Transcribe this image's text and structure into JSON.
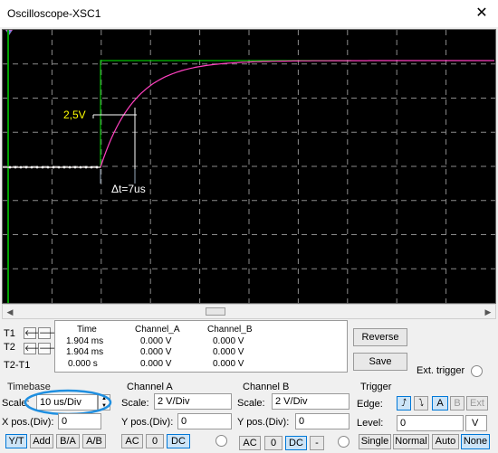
{
  "window": {
    "title": "Oscilloscope-XSC1",
    "close_glyph": "✕"
  },
  "screen": {
    "annotation_voltage": "2,5V",
    "annotation_delta": "Δt=7us",
    "trace_colors": {
      "channel_a": "#00c000",
      "channel_b": "#ff40c0",
      "cursor": "#ffffff",
      "grid": "#808080",
      "annotation": "#ffff00"
    }
  },
  "cursors": {
    "t1_label": "T1",
    "t2_label": "T2",
    "diff_label": "T2-T1",
    "arrow_left": "🡐",
    "arrow_right": "🡒"
  },
  "readout": {
    "headers": [
      "Time",
      "Channel_A",
      "Channel_B"
    ],
    "rows": [
      [
        "1.904 ms",
        "0.000 V",
        "0.000 V"
      ],
      [
        "1.904 ms",
        "0.000 V",
        "0.000 V"
      ],
      [
        "0.000 s",
        "0.000 V",
        "0.000 V"
      ]
    ]
  },
  "actions": {
    "reverse": "Reverse",
    "save": "Save",
    "ext_trigger": "Ext. trigger"
  },
  "timebase": {
    "group": "Timebase",
    "scale_label": "Scale:",
    "scale_value": "10 us/Div",
    "xpos_label": "X pos.(Div):",
    "xpos_value": "0",
    "modes": [
      "Y/T",
      "Add",
      "B/A",
      "A/B"
    ],
    "active_mode": "Y/T"
  },
  "channel_a": {
    "group": "Channel A",
    "scale_label": "Scale:",
    "scale_value": "2  V/Div",
    "ypos_label": "Y pos.(Div):",
    "ypos_value": "0",
    "coupling": [
      "AC",
      "0",
      "DC"
    ],
    "active_coupling": "DC"
  },
  "channel_b": {
    "group": "Channel B",
    "scale_label": "Scale:",
    "scale_value": "2  V/Div",
    "ypos_label": "Y pos.(Div):",
    "ypos_value": "0",
    "coupling": [
      "AC",
      "0",
      "DC",
      "-"
    ],
    "active_coupling": "DC"
  },
  "trigger": {
    "group": "Trigger",
    "edge_label": "Edge:",
    "edge_rising": "⭜",
    "edge_falling": "⭝",
    "sources": [
      "A",
      "B",
      "Ext"
    ],
    "active_source": "A",
    "level_label": "Level:",
    "level_value": "0",
    "level_unit": "V",
    "modes": [
      "Single",
      "Normal",
      "Auto",
      "None"
    ],
    "active_mode": "None"
  }
}
